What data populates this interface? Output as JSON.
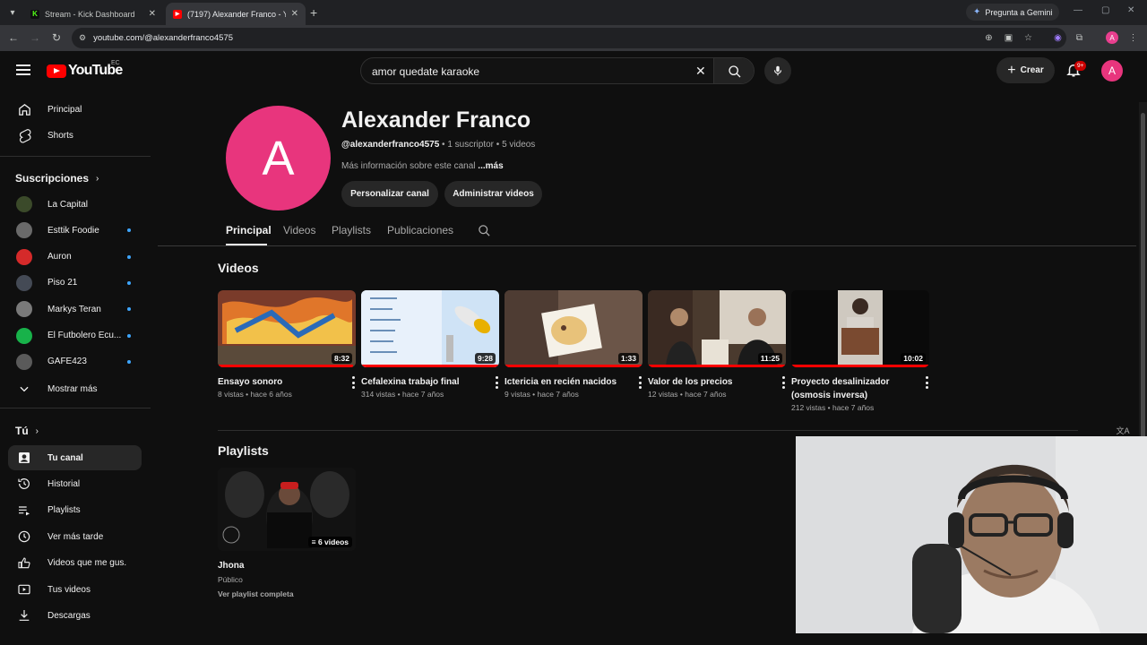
{
  "browser": {
    "tabs": [
      {
        "title": "Stream - Kick Dashboard",
        "favicon": "kick-icon"
      },
      {
        "title": "(7197) Alexander Franco - YouT",
        "favicon": "youtube-icon"
      }
    ],
    "gemini_label": "Pregunta a Gemini",
    "url": "youtube.com/@alexanderfranco4575",
    "profile_initial": "A"
  },
  "topbar": {
    "logo_text": "YouTube",
    "country_code": "EC",
    "search_value": "amor quedate karaoke",
    "create_label": "Crear",
    "notif_badge": "9+",
    "avatar_initial": "A"
  },
  "sidebar": {
    "main": [
      {
        "label": "Principal",
        "icon": "home-icon"
      },
      {
        "label": "Shorts",
        "icon": "shorts-icon"
      }
    ],
    "subs_title": "Suscripciones",
    "subscriptions": [
      {
        "label": "La Capital",
        "color": "#3b4a2a",
        "dot": false
      },
      {
        "label": "Esttik Foodie",
        "color": "#6a6a6a",
        "dot": true
      },
      {
        "label": "Auron",
        "color": "#d52a2a",
        "dot": true
      },
      {
        "label": "Piso 21",
        "color": "#444a55",
        "dot": true
      },
      {
        "label": "Markys Teran",
        "color": "#7a7a7a",
        "dot": true
      },
      {
        "label": "El Futbolero Ecu...",
        "color": "#18b24a",
        "dot": true
      },
      {
        "label": "GAFE423",
        "color": "#5a5a5a",
        "dot": true
      }
    ],
    "show_more": "Mostrar más",
    "you_title": "Tú",
    "you_items": [
      {
        "label": "Tu canal",
        "icon": "channel-icon",
        "active": true
      },
      {
        "label": "Historial",
        "icon": "history-icon"
      },
      {
        "label": "Playlists",
        "icon": "playlists-icon"
      },
      {
        "label": "Ver más tarde",
        "icon": "clock-icon"
      },
      {
        "label": "Videos que me gus...",
        "icon": "like-icon"
      },
      {
        "label": "Tus videos",
        "icon": "your-videos-icon"
      },
      {
        "label": "Descargas",
        "icon": "download-icon"
      }
    ]
  },
  "channel": {
    "avatar_initial": "A",
    "name": "Alexander Franco",
    "handle": "@alexanderfranco4575",
    "subscribers": " • 1 suscriptor • 5 videos",
    "more_info": "Más información sobre este canal ",
    "more_link": "...más",
    "customize_label": "Personalizar canal",
    "manage_label": "Administrar videos",
    "tabs": [
      "Principal",
      "Videos",
      "Playlists",
      "Publicaciones"
    ]
  },
  "videos_section": {
    "title": "Videos",
    "items": [
      {
        "title": "Ensayo sonoro",
        "meta": "8 vistas • hace 6 años",
        "duration": "8:32",
        "progress": 0.98
      },
      {
        "title": "Cefalexina trabajo final",
        "meta": "314 vistas • hace 7 años",
        "duration": "9:28",
        "progress": 1.0
      },
      {
        "title": "Ictericia en recién nacidos",
        "meta": "9 vistas • hace 7 años",
        "duration": "1:33",
        "progress": 1.0
      },
      {
        "title": "Valor de los precios",
        "meta": "12 vistas • hace 7 años",
        "duration": "11:25",
        "progress": 1.0
      },
      {
        "title": "Proyecto desalinizador (osmosis inversa)",
        "meta": "212 vistas • hace 7 años",
        "duration": "10:02",
        "progress": 1.0
      }
    ]
  },
  "playlists_section": {
    "title": "Playlists",
    "items": [
      {
        "title": "Jhona",
        "privacy": "Público",
        "link": "Ver playlist completa",
        "count": "6 videos"
      }
    ]
  },
  "colors": {
    "youtube_red": "#ff0000",
    "avatar_pink": "#e8357d",
    "background": "#0f0f0f"
  }
}
